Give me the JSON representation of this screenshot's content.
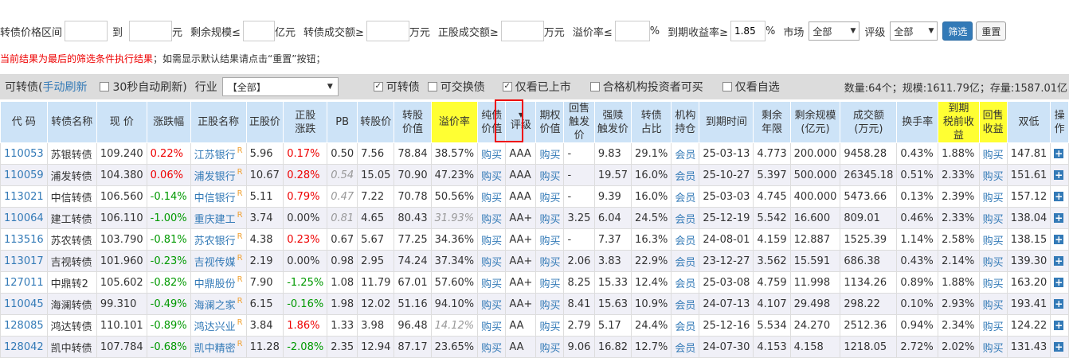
{
  "filter": {
    "price_range_label": "转债价格区间",
    "to_label": "到",
    "yuan_label": "元",
    "remain_size_label": "剩余规模≤",
    "yi_yuan_label": "亿元",
    "cb_volume_label": "转债成交额≥",
    "wan_yuan_label": "万元",
    "stock_volume_label": "正股成交额≥",
    "wan_yuan_label2": "万元",
    "premium_label": "溢价率≤",
    "percent_label": "%",
    "ytm_label": "到期收益率≥",
    "ytm_value": "1.85",
    "percent_label2": "%",
    "market_label": "市场",
    "market_value": "全部",
    "rating_label": "评级",
    "rating_value": "全部",
    "filter_button": "筛选",
    "reset_button": "重置"
  },
  "notice": {
    "red_text": "当前结果为最后的筛选条件执行结果",
    "rest_text": "；如需显示默认结果请点击“重置”按钮；"
  },
  "toolbar": {
    "prefix": "可转债(",
    "manual_refresh": "手动刷新",
    "auto_refresh": "30秒自动刷新)",
    "industry_label": "行业",
    "industry_value": "【全部】",
    "cb_label": "可转债",
    "exchangeable_label": "可交换债",
    "listed_only_label": "仅看已上市",
    "institutional_label": "合格机构投资者可买",
    "self_select_label": "仅看自选",
    "stats": "数量:64个；规模:1611.79亿；存量:1587.01亿"
  },
  "table": {
    "headers": [
      "代 码",
      "转债名称",
      "现 价",
      "涨跌幅",
      "正股名称",
      "正股价",
      "正股\n涨跌",
      "PB",
      "转股价",
      "转股\n价值",
      "溢价率",
      "纯债\n价值",
      "评级",
      "期权\n价值",
      "回售\n触发价",
      "强赎\n触发价",
      "转债\n占比",
      "机构\n持仓",
      "到期时间",
      "剩余\n年限",
      "剩余规模\n(亿元)",
      "成交额\n(万元)",
      "换手率",
      "到期\n税前收益",
      "回售\n收益",
      "双低",
      "操作"
    ],
    "buy_label": "购买",
    "member_label": "会员",
    "rows": [
      {
        "code": "110053",
        "name": "苏银转债",
        "price": "109.240",
        "chg": "0.22%",
        "stock": "江苏银行",
        "sp": "5.96",
        "schg": "0.17%",
        "pb": "0.50",
        "cvp": "7.56",
        "cvv": "78.84",
        "prem": "38.57%",
        "rating": "AAA",
        "put": "-",
        "call": "9.83",
        "ratio": "29.1%",
        "due": "25-03-13",
        "yrs": "4.773",
        "size": "200.000",
        "vol": "9458.28",
        "turn": "0.43%",
        "ytm": "1.88%",
        "dl": "147.81"
      },
      {
        "code": "110059",
        "name": "浦发转债",
        "price": "104.380",
        "chg": "0.06%",
        "stock": "浦发银行",
        "sp": "10.67",
        "schg": "0.28%",
        "pb": "0.54",
        "cvp": "15.05",
        "cvv": "70.90",
        "prem": "47.23%",
        "rating": "AAA",
        "put": "-",
        "call": "19.57",
        "ratio": "16.0%",
        "due": "25-10-27",
        "yrs": "5.397",
        "size": "500.000",
        "vol": "26345.18",
        "turn": "0.51%",
        "ytm": "2.33%",
        "dl": "151.61"
      },
      {
        "code": "113021",
        "name": "中信转债",
        "price": "106.560",
        "chg": "-0.14%",
        "stock": "中信银行",
        "sp": "5.11",
        "schg": "0.79%",
        "pb": "0.47",
        "cvp": "7.22",
        "cvv": "70.78",
        "prem": "50.56%",
        "rating": "AAA",
        "put": "-",
        "call": "9.39",
        "ratio": "16.0%",
        "due": "25-03-03",
        "yrs": "4.745",
        "size": "400.000",
        "vol": "5473.66",
        "turn": "0.13%",
        "ytm": "2.39%",
        "dl": "157.12"
      },
      {
        "code": "110064",
        "name": "建工转债",
        "price": "106.110",
        "chg": "-1.00%",
        "stock": "重庆建工",
        "sp": "3.74",
        "schg": "0.00%",
        "pb": "0.81",
        "cvp": "4.65",
        "cvv": "80.43",
        "prem": "31.93%",
        "rating": "AA+",
        "put": "3.25",
        "call": "6.04",
        "ratio": "24.5%",
        "due": "25-12-19",
        "yrs": "5.542",
        "size": "16.600",
        "vol": "809.01",
        "turn": "0.46%",
        "ytm": "2.33%",
        "dl": "138.04"
      },
      {
        "code": "113516",
        "name": "苏农转债",
        "price": "103.790",
        "chg": "-0.81%",
        "stock": "苏农银行",
        "sp": "4.38",
        "schg": "0.23%",
        "pb": "0.67",
        "cvp": "5.67",
        "cvv": "77.25",
        "prem": "34.36%",
        "rating": "AA+",
        "put": "-",
        "call": "7.37",
        "ratio": "16.3%",
        "due": "24-08-01",
        "yrs": "4.159",
        "size": "12.887",
        "vol": "1525.39",
        "turn": "1.14%",
        "ytm": "2.58%",
        "dl": "138.15"
      },
      {
        "code": "113017",
        "name": "吉视转债",
        "price": "101.960",
        "chg": "-0.23%",
        "stock": "吉视传媒",
        "sp": "2.19",
        "schg": "0.00%",
        "pb": "0.98",
        "cvp": "2.95",
        "cvv": "74.24",
        "prem": "37.34%",
        "rating": "AA+",
        "put": "2.06",
        "call": "3.83",
        "ratio": "22.9%",
        "due": "23-12-27",
        "yrs": "3.562",
        "size": "15.591",
        "vol": "686.38",
        "turn": "0.43%",
        "ytm": "2.14%",
        "dl": "139.30"
      },
      {
        "code": "127011",
        "name": "中鼎转2",
        "price": "105.602",
        "chg": "-0.82%",
        "stock": "中鼎股份",
        "sp": "7.90",
        "schg": "-1.25%",
        "pb": "1.08",
        "cvp": "11.79",
        "cvv": "67.01",
        "prem": "57.60%",
        "rating": "AA+",
        "put": "8.25",
        "call": "15.33",
        "ratio": "12.4%",
        "due": "25-03-08",
        "yrs": "4.759",
        "size": "11.998",
        "vol": "1134.26",
        "turn": "0.89%",
        "ytm": "1.88%",
        "dl": "163.20"
      },
      {
        "code": "110045",
        "name": "海澜转债",
        "price": "99.310",
        "chg": "-0.49%",
        "stock": "海澜之家",
        "sp": "6.15",
        "schg": "-0.16%",
        "pb": "1.98",
        "cvp": "12.02",
        "cvv": "51.16",
        "prem": "94.10%",
        "rating": "AA+",
        "put": "8.41",
        "call": "15.63",
        "ratio": "10.9%",
        "due": "24-07-13",
        "yrs": "4.107",
        "size": "29.498",
        "vol": "298.22",
        "turn": "0.10%",
        "ytm": "2.93%",
        "dl": "193.41"
      },
      {
        "code": "128085",
        "name": "鸿达转债",
        "price": "110.101",
        "chg": "-0.89%",
        "stock": "鸿达兴业",
        "sp": "3.84",
        "schg": "1.86%",
        "pb": "1.33",
        "cvp": "3.98",
        "cvv": "96.48",
        "prem": "14.12%",
        "rating": "AA",
        "put": "2.79",
        "call": "5.17",
        "ratio": "24.4%",
        "due": "25-12-16",
        "yrs": "5.534",
        "size": "24.270",
        "vol": "2512.36",
        "turn": "0.94%",
        "ytm": "2.34%",
        "dl": "124.22"
      },
      {
        "code": "128042",
        "name": "凯中转债",
        "price": "107.784",
        "chg": "-0.68%",
        "stock": "凯中精密",
        "sp": "11.28",
        "schg": "-2.08%",
        "pb": "2.35",
        "cvp": "12.94",
        "cvv": "87.17",
        "prem": "23.65%",
        "rating": "AA",
        "put": "9.06",
        "call": "16.82",
        "ratio": "12.7%",
        "due": "24-07-30",
        "yrs": "4.153",
        "size": "4.158",
        "vol": "1218.05",
        "turn": "2.72%",
        "ytm": "2.02%",
        "dl": "131.43"
      }
    ]
  }
}
